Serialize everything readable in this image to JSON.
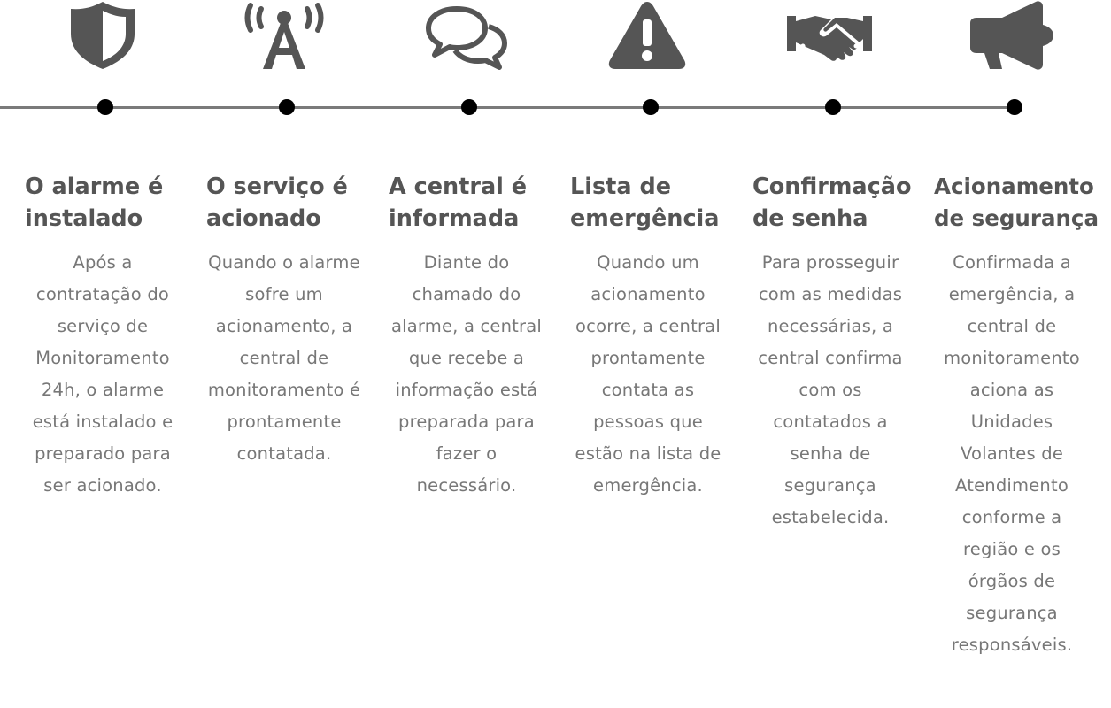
{
  "colors": {
    "icon": "#555555",
    "heading": "#555555",
    "body_text": "#777777",
    "line": "#7a7a7a",
    "dot": "#000000"
  },
  "steps": [
    {
      "icon": "shield-icon",
      "title": "O alarme é instalado",
      "description": "Após a contratação do serviço de Monitoramento 24h, o alarme está instalado e preparado para ser acionado."
    },
    {
      "icon": "antenna-broadcast-icon",
      "title": "O serviço é acionado",
      "description": "Quando o alarme sofre um acionamento, a central de monitoramento é prontamente contatada."
    },
    {
      "icon": "chat-bubbles-icon",
      "title": "A central é informada",
      "description": "Diante do chamado do alarme, a central que recebe a informação está preparada para fazer o necessário."
    },
    {
      "icon": "warning-icon",
      "title": "Lista de emergência",
      "description": "Quando um acionamento ocorre, a central prontamente contata as pessoas que estão na lista de emergência."
    },
    {
      "icon": "handshake-icon",
      "title": "Confirmação de senha",
      "description": "Para prosseguir com as medidas necessárias, a central confirma com os contatados a senha de segurança estabelecida."
    },
    {
      "icon": "megaphone-icon",
      "title": "Acionamento de segurança",
      "description": "Confirmada a emergência, a central de monitoramento aciona as Unidades Volantes de Atendimento conforme a região e os órgãos de segurança responsáveis."
    }
  ]
}
